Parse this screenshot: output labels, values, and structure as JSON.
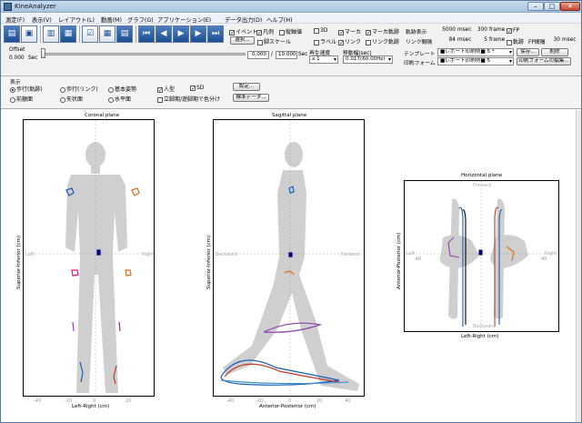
{
  "app": {
    "title": "KineAnalyzer"
  },
  "menu": [
    "測定(F)",
    "表示(V)",
    "レイアウト(L)",
    "動画(M)",
    "グラフ(G)",
    "アプリケーション(E)",
    "データ出力(D)",
    "ヘルプ(H)"
  ],
  "toolbar": {
    "offset_label": "Offset",
    "offset_value": "0.000",
    "sec": "Sec",
    "time_current": "0.000",
    "time_sep": "/",
    "time_total": "10.000",
    "time_sec": "Sec",
    "checks_left": [
      {
        "label": "イベント",
        "checked": true
      },
      {
        "label": "凡例",
        "checked": true
      },
      {
        "label": "縦軸値",
        "checked": false
      }
    ],
    "select_button": "選択...",
    "foot_scale": {
      "label": "脚スケール",
      "checked": false
    },
    "checks_mid": [
      {
        "label": "3D",
        "checked": false
      },
      {
        "label": "マーカ",
        "checked": true
      },
      {
        "label": "マーカ軌跡",
        "checked": true
      },
      {
        "label": "ラベル",
        "checked": false
      },
      {
        "label": "リンク",
        "checked": true
      },
      {
        "label": "リンク軌跡",
        "checked": false
      }
    ],
    "playback_speed": "再生速度",
    "playback_value": "x 1",
    "move_label": "移動幅(sec)",
    "move_value": "0.017(60.00Hz)",
    "trajectory_label": "軌跡表示",
    "trajectory_msec": "5000",
    "trajectory_unit": "msec",
    "trajectory_frame": "300",
    "frame_unit": "frame",
    "link_interval_label": "リンク間隔",
    "link_msec": "84",
    "link_frame": "5",
    "template_label": "テンプレート",
    "template_value": "■レポート印刷例■ 5 *",
    "print_form_label": "印刷フォーム",
    "print_form_value": "■レポート印刷例■ 5",
    "save_button": "保存...",
    "delete_button": "削除",
    "edit_print_button": "印刷フォームの編集...",
    "fp": {
      "label": "FP",
      "checked": true
    },
    "trajectory_check": {
      "label": "軌跡",
      "checked": false
    },
    "fp_interval_label": "FP間隔",
    "fp_interval_value": "30",
    "fp_interval_unit": "msec"
  },
  "display": {
    "title": "表示",
    "radios": [
      {
        "label": "歩行(軌跡)",
        "on": true
      },
      {
        "label": "歩行(リンク)",
        "on": false
      },
      {
        "label": "基本姿勢",
        "on": false
      },
      {
        "label": "前額面",
        "on": false
      },
      {
        "label": "矢状面",
        "on": false
      },
      {
        "label": "水平面",
        "on": false
      }
    ],
    "human": {
      "label": "人型",
      "checked": true
    },
    "sd": {
      "label": "SD",
      "checked": true
    },
    "stand_split": {
      "label": "立脚期/遊脚期で色分け",
      "checked": false
    },
    "settings_button": "設定...",
    "standard_data_button": "標準データ..."
  },
  "plots": {
    "coronal": {
      "title": "Coronal plane",
      "xlabel": "Left-Right (cm)",
      "ylabel": "Superior-Inferior (cm)",
      "left": "Left",
      "right": "Right",
      "ticks": [
        "-40",
        "-20",
        "0",
        "20",
        "40"
      ]
    },
    "sagittal": {
      "title": "Sagittal plane",
      "xlabel": "Anterior-Posterior (cm)",
      "ylabel": "Superior-Inferior (cm)",
      "left": "Backward",
      "right": "Forward",
      "ticks": [
        "-40",
        "-20",
        "0",
        "20",
        "40"
      ]
    },
    "horizontal": {
      "title": "Horizontal plane",
      "xlabel": "Left-Right (cm)",
      "ylabel": "Anterior-Posterior (cm)",
      "top": "Forward",
      "bottom": "Backward",
      "left": "Left",
      "right": "Right",
      "ticks": [
        "-40",
        "-20",
        "0",
        "20",
        "40"
      ]
    }
  },
  "colors": {
    "silhouette": "#cfcfcf",
    "accent": "#1d4e91"
  }
}
